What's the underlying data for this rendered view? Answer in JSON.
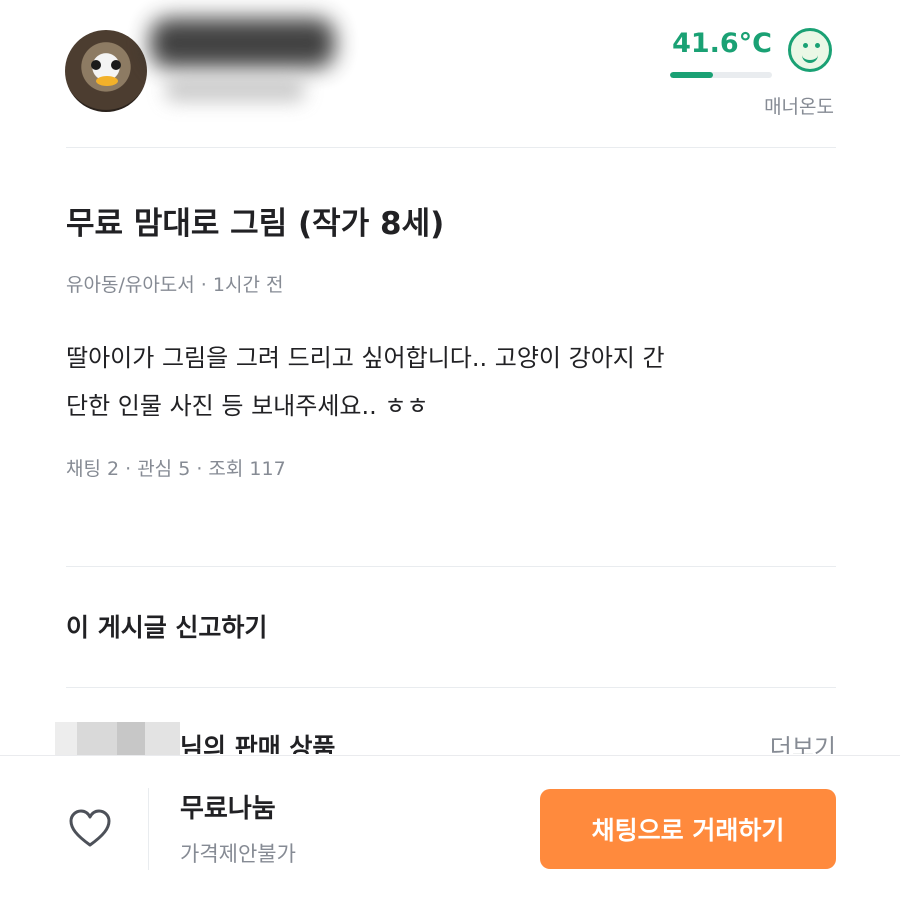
{
  "profile": {
    "temperature": "41.6°C",
    "temperature_level": 0.42,
    "manner_label": "매너온도",
    "colors": {
      "accent": "#1aa174"
    }
  },
  "post": {
    "title": "무료 맘대로 그림 (작가 8세)",
    "meta": "유아동/유아도서 · 1시간 전",
    "body_lines": [
      "딸아이가 그림을 그려 드리고 싶어합니다.. 고양이 강아지 간",
      "단한 인물 사진 등 보내주세요.. ㅎㅎ"
    ],
    "stats": "채팅 2 · 관심 5 · 조회 117"
  },
  "report_label": "이 게시글 신고하기",
  "seller_section": {
    "title": "님의 판매 상품",
    "more_label": "더보기"
  },
  "bottom_bar": {
    "price": "무료나눔",
    "negotiation": "가격제안불가",
    "chat_button": "채팅으로 거래하기",
    "colors": {
      "button": "#ff8a3d"
    },
    "icons": {
      "like": "heart-icon"
    }
  }
}
